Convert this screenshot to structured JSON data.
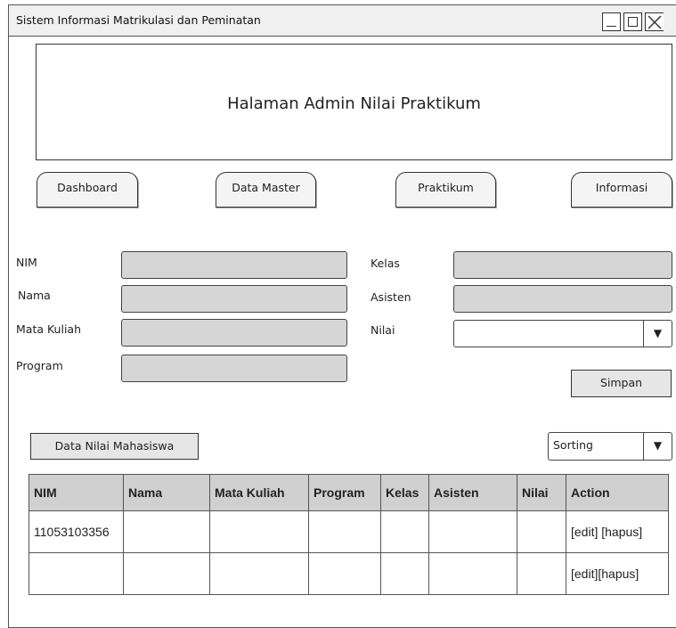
{
  "window": {
    "title": "Sistem Informasi Matrikulasi dan Peminatan"
  },
  "header": {
    "title": "Halaman Admin Nilai Praktikum"
  },
  "nav": {
    "tabs": [
      {
        "label": "Dashboard"
      },
      {
        "label": "Data Master"
      },
      {
        "label": "Praktikum"
      },
      {
        "label": "Informasi"
      }
    ]
  },
  "form": {
    "nim_label": "NIM",
    "nama_label": "Nama",
    "matakuliah_label": "Mata Kuliah",
    "program_label": "Program",
    "kelas_label": "Kelas",
    "asisten_label": "Asisten",
    "nilai_label": "Nilai",
    "nilai_value": "",
    "save_label": "Simpan"
  },
  "section": {
    "data_label": "Data Nilai Mahasiswa",
    "sort_value": "Sorting"
  },
  "table": {
    "headers": [
      "NIM",
      "Nama",
      "Mata Kuliah",
      "Program",
      "Kelas",
      "Asisten",
      "Nilai",
      "Action"
    ],
    "rows": [
      [
        "11053103356",
        "",
        "",
        "",
        "",
        "",
        "",
        "[edit] [hapus]"
      ],
      [
        "",
        "",
        "",
        "",
        "",
        "",
        "",
        "[edit][hapus]"
      ]
    ]
  },
  "icons": {
    "minimize": "minimize-icon",
    "maximize": "maximize-icon",
    "close": "close-icon",
    "dropdown": "triangle-down-icon"
  }
}
